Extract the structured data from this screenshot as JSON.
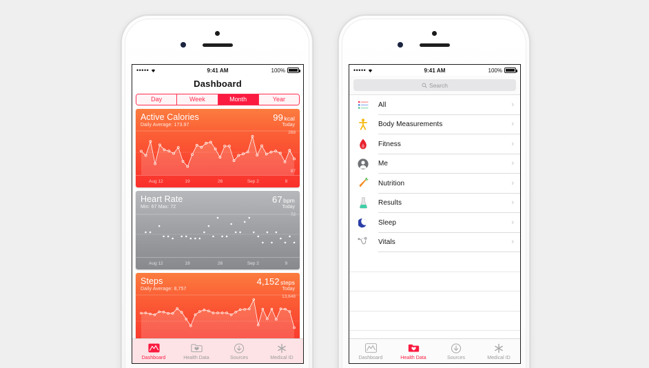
{
  "status_bar": {
    "signal": "•••••",
    "wifi_icon": "wifi-icon",
    "time": "9:41 AM",
    "battery_pct": "100%"
  },
  "left_phone": {
    "nav_title": "Dashboard",
    "segmented": {
      "options": [
        "Day",
        "Week",
        "Month",
        "Year"
      ],
      "selected": "Month"
    },
    "cards": [
      {
        "name": "active-calories",
        "title": "Active Calories",
        "subtitle": "Daily Average: 173.97",
        "value": "99",
        "unit": "kcal",
        "period": "Today",
        "axis_max": "268",
        "axis_min": "87",
        "x_labels": [
          "Aug 12",
          "19",
          "26",
          "Sep 2",
          "9"
        ]
      },
      {
        "name": "heart-rate",
        "title": "Heart Rate",
        "subtitle": "Min: 67  Max: 72",
        "value": "67",
        "unit": "bpm",
        "period": "Today",
        "axis_max": "72",
        "axis_min": "",
        "x_labels": [
          "Aug 12",
          "19",
          "26",
          "Sep 2",
          "9"
        ]
      },
      {
        "name": "steps",
        "title": "Steps",
        "subtitle": "Daily Average: 8,757",
        "value": "4,152",
        "unit": "steps",
        "period": "Today",
        "axis_max": "13,648",
        "axis_min": "",
        "x_labels": [
          "Aug 12",
          "19",
          "26",
          "Sep 2",
          "9"
        ]
      }
    ],
    "tabs": [
      {
        "label": "Dashboard",
        "icon": "dashboard-chart-icon",
        "active": true
      },
      {
        "label": "Health Data",
        "icon": "health-folder-icon",
        "active": false
      },
      {
        "label": "Sources",
        "icon": "sources-download-icon",
        "active": false
      },
      {
        "label": "Medical ID",
        "icon": "medical-id-star-icon",
        "active": false
      }
    ]
  },
  "right_phone": {
    "search": {
      "placeholder": "Search",
      "icon": "search-icon"
    },
    "list_items": [
      {
        "label": "All",
        "icon": "all-list-icon"
      },
      {
        "label": "Body Measurements",
        "icon": "body-measurements-icon"
      },
      {
        "label": "Fitness",
        "icon": "fitness-flame-icon"
      },
      {
        "label": "Me",
        "icon": "me-person-icon"
      },
      {
        "label": "Nutrition",
        "icon": "nutrition-carrot-icon"
      },
      {
        "label": "Results",
        "icon": "results-flask-icon"
      },
      {
        "label": "Sleep",
        "icon": "sleep-moon-icon"
      },
      {
        "label": "Vitals",
        "icon": "vitals-stethoscope-icon"
      }
    ],
    "tabs": [
      {
        "label": "Dashboard",
        "icon": "dashboard-chart-icon",
        "active": false
      },
      {
        "label": "Health Data",
        "icon": "health-folder-icon",
        "active": true
      },
      {
        "label": "Sources",
        "icon": "sources-download-icon",
        "active": false
      },
      {
        "label": "Medical ID",
        "icon": "medical-id-star-icon",
        "active": false
      }
    ]
  },
  "colors": {
    "accent_red": "#fb1b40",
    "orange": "#fb6236",
    "gray": "#9b9da1",
    "tab_inactive": "#9a9a9a"
  },
  "chart_data": [
    {
      "type": "line",
      "title": "Active Calories",
      "ylabel": "kcal",
      "ylim": [
        87,
        268
      ],
      "x_ticks": [
        "Aug 12",
        "19",
        "26",
        "Sep 2",
        "9"
      ],
      "values": [
        175,
        150,
        232,
        101,
        212,
        183,
        176,
        162,
        197,
        115,
        85,
        155,
        210,
        198,
        222,
        228,
        188,
        139,
        205,
        205,
        119,
        150,
        159,
        171,
        262,
        152,
        207,
        158,
        170,
        176,
        163,
        112,
        180,
        130
      ],
      "grid": true,
      "legend": "none"
    },
    {
      "type": "scatter",
      "title": "Heart Rate",
      "ylabel": "bpm",
      "ylim": [
        64,
        73
      ],
      "x_ticks": [
        "Aug 12",
        "19",
        "26",
        "Sep 2",
        "9"
      ],
      "points": [
        [
          1,
          69
        ],
        [
          2,
          69
        ],
        [
          4,
          70.5
        ],
        [
          5,
          68
        ],
        [
          6,
          68
        ],
        [
          7,
          67.5
        ],
        [
          9,
          68
        ],
        [
          10,
          68
        ],
        [
          11,
          67.5
        ],
        [
          12,
          67.5
        ],
        [
          13,
          67.5
        ],
        [
          14,
          69
        ],
        [
          15,
          70.5
        ],
        [
          16,
          68
        ],
        [
          17,
          72.5
        ],
        [
          18,
          68
        ],
        [
          19,
          68
        ],
        [
          20,
          71
        ],
        [
          21,
          69
        ],
        [
          22,
          69
        ],
        [
          23,
          71.5
        ],
        [
          24,
          72.5
        ],
        [
          25,
          69
        ],
        [
          26,
          68
        ],
        [
          27,
          66.5
        ],
        [
          28,
          69
        ],
        [
          29,
          66.5
        ],
        [
          30,
          69
        ],
        [
          31,
          67.5
        ],
        [
          32,
          66.5
        ],
        [
          33,
          68
        ],
        [
          34,
          66.5
        ]
      ],
      "grid": true,
      "legend": "none"
    },
    {
      "type": "area",
      "title": "Steps",
      "ylabel": "steps",
      "ylim": [
        0,
        13648
      ],
      "x_ticks": [
        "Aug 12",
        "19",
        "26",
        "Sep 2",
        "9"
      ],
      "values": [
        8600,
        8700,
        8300,
        8000,
        9100,
        9000,
        8500,
        8500,
        10300,
        8900,
        6400,
        3900,
        8000,
        9200,
        9800,
        9400,
        8700,
        8700,
        8700,
        8700,
        8000,
        9000,
        9900,
        10000,
        10200,
        13648,
        4200,
        10100,
        6500,
        10100,
        6300,
        10200,
        10100,
        9200,
        3200
      ],
      "grid": true,
      "legend": "none"
    }
  ]
}
